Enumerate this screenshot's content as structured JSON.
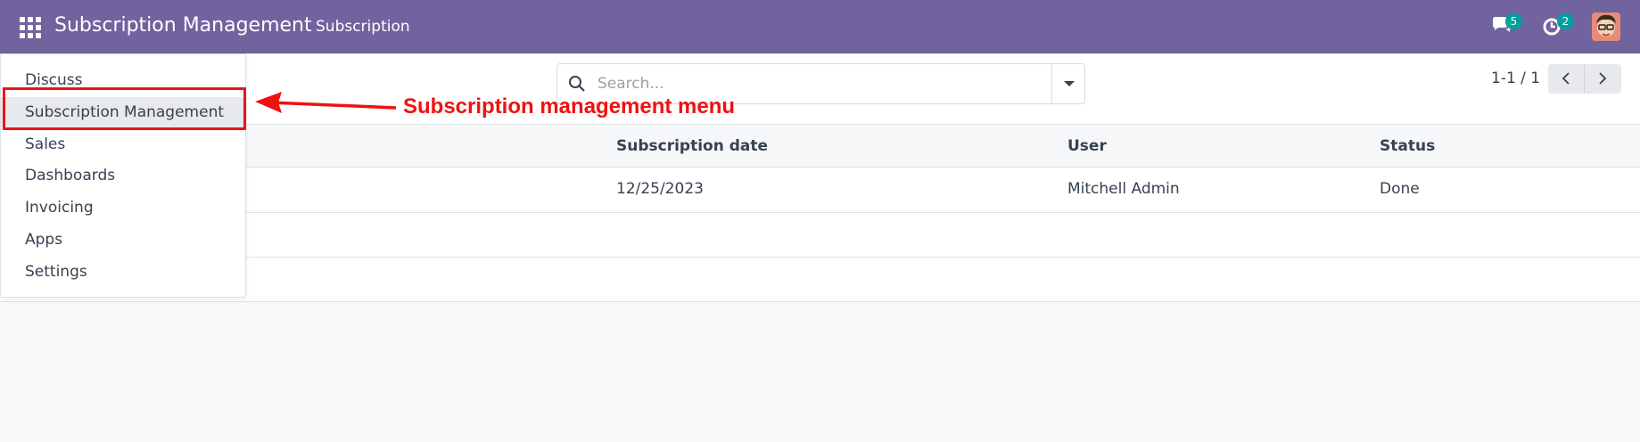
{
  "navbar": {
    "brand": "Subscription Management",
    "menu_item": "Subscription",
    "messages_badge": "5",
    "activities_badge": "2",
    "color": "#71639e"
  },
  "search": {
    "placeholder": "Search..."
  },
  "pager": {
    "value": "1-1 / 1"
  },
  "table": {
    "columns": [
      "Subscription date",
      "User",
      "Status"
    ],
    "rows": [
      {
        "subscription_date": "12/25/2023",
        "user": "Mitchell Admin",
        "status": "Done"
      }
    ]
  },
  "apps_menu": {
    "items": [
      {
        "label": "Discuss"
      },
      {
        "label": "Subscription Management"
      },
      {
        "label": "Sales"
      },
      {
        "label": "Dashboards"
      },
      {
        "label": "Invoicing"
      },
      {
        "label": "Apps"
      },
      {
        "label": "Settings"
      }
    ],
    "active_item": "Subscription Management"
  },
  "annotation": {
    "text": "Subscription management menu",
    "color": "#f01111"
  }
}
